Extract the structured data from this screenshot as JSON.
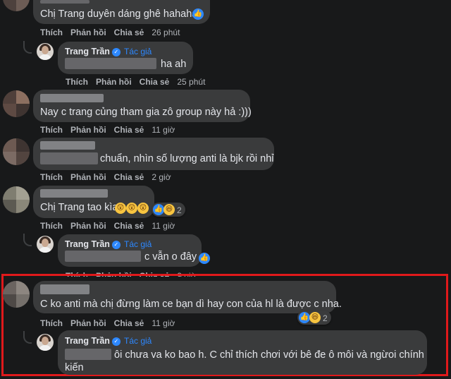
{
  "comments": [
    {
      "text": "Chị Trang duyên dáng ghê hahaha",
      "actions": {
        "like": "Thích",
        "reply": "Phản hồi",
        "share": "Chia sẻ",
        "time": "26 phút"
      },
      "reply": {
        "author": "Trang Trần",
        "author_tag": "Tác giả",
        "text": "ha ah",
        "actions": {
          "like": "Thích",
          "reply": "Phản hồi",
          "share": "Chia sẻ",
          "time": "25 phút"
        }
      }
    },
    {
      "text": "Nay c trang củng tham gia zô group này hả :)))",
      "actions": {
        "like": "Thích",
        "reply": "Phản hồi",
        "share": "Chia sẻ",
        "time": "11 giờ"
      }
    },
    {
      "text": "chuẩn, nhìn số lượng anti là bjk rồi nhỉ",
      "actions": {
        "like": "Thích",
        "reply": "Phản hồi",
        "share": "Chia sẻ",
        "time": "2 giờ"
      }
    },
    {
      "text": "Chị Trang tao kìa",
      "reaction_count": "2",
      "actions": {
        "like": "Thích",
        "reply": "Phản hồi",
        "share": "Chia sẻ",
        "time": "11 giờ"
      },
      "reply": {
        "author": "Trang Trần",
        "author_tag": "Tác giả",
        "text": "c vẫn o đây",
        "actions": {
          "like": "Thích",
          "reply": "Phản hồi",
          "share": "Chia sẻ",
          "time": "9 giờ"
        }
      }
    },
    {
      "text": "C ko anti mà chị đừng làm ce bạn dì hay con của hl là được c nha.",
      "reaction_count": "2",
      "actions": {
        "like": "Thích",
        "reply": "Phản hồi",
        "share": "Chia sẻ",
        "time": "11 giờ"
      },
      "reply": {
        "author": "Trang Trần",
        "author_tag": "Tác giả",
        "text_line1": "ôi chưa va ko bao h. C chỉ thích chơi với bê đe ô môi và ngừoi chính",
        "text_line2": "kiến"
      }
    }
  ],
  "highlight_color": "#e0191b",
  "accent_color": "#2d88ff"
}
